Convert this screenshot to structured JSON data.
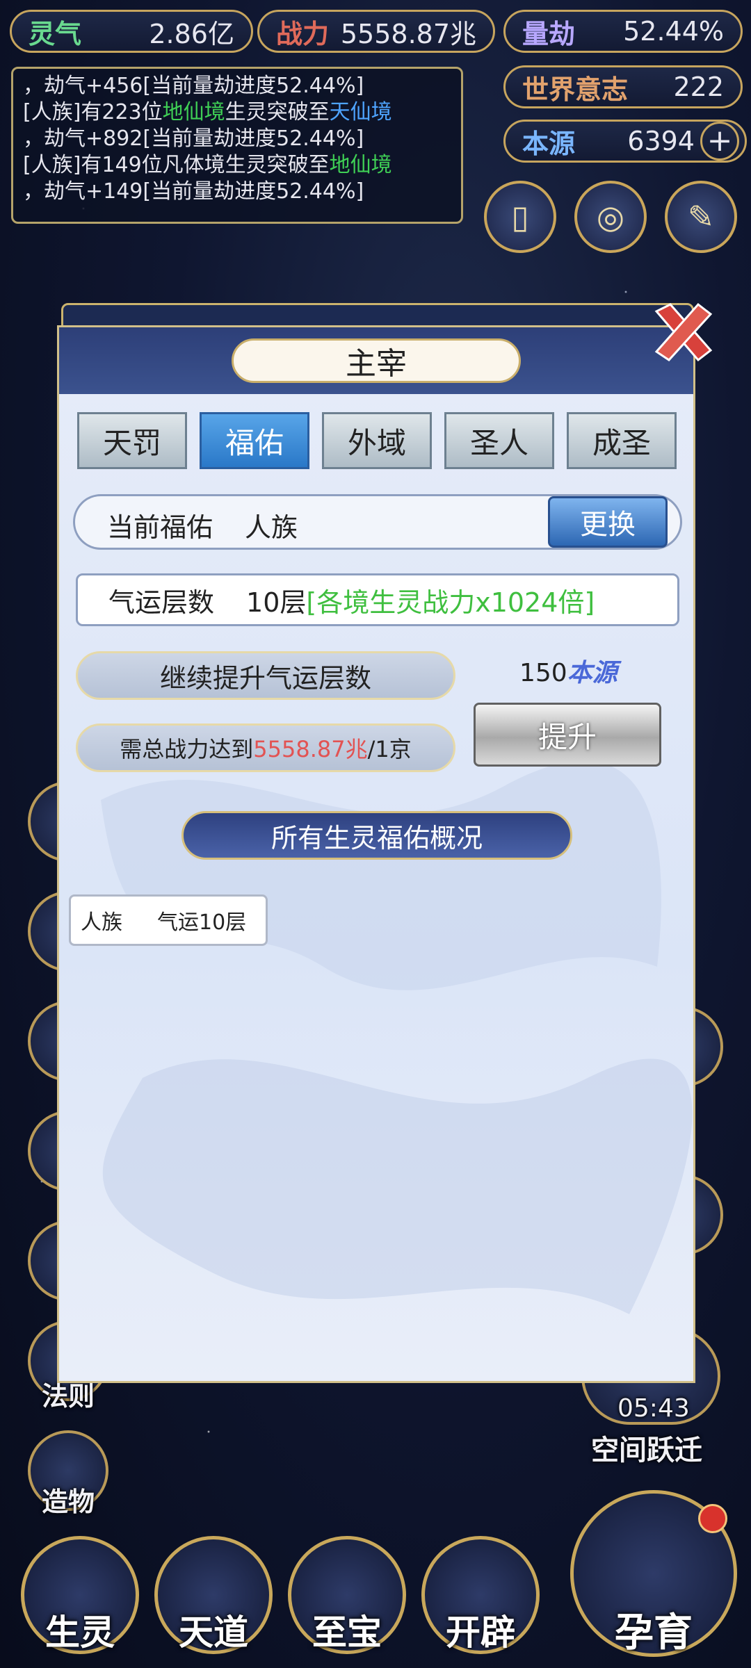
{
  "hud": {
    "lingqi": {
      "label": "灵气",
      "value": "2.86亿"
    },
    "zhanli": {
      "label": "战力",
      "value": "5558.87兆"
    },
    "liangjie": {
      "label": "量劫",
      "value": "52.44%"
    },
    "shijie": {
      "label": "世界意志",
      "value": "222"
    },
    "benyuan": {
      "label": "本源",
      "value": "6394"
    }
  },
  "log": {
    "line1": "，劫气+456[当前量劫进度52.44%]",
    "line2a": "[人族]有223位",
    "line2b": "地仙境",
    "line2c": "生灵突破至",
    "line2d": "天仙境",
    "line3": "，劫气+892[当前量劫进度52.44%]",
    "line4a": "[人族]有149位凡体境生灵突破至",
    "line4b": "地仙境",
    "line5": "，劫气+149[当前量劫进度52.44%]"
  },
  "side_left": [
    "法则",
    "造物"
  ],
  "space_jump": {
    "time": "05:43",
    "label": "空间跃迁"
  },
  "bottom_nav": [
    "生灵",
    "天道",
    "至宝",
    "开辟"
  ],
  "bottom_main": "孕育",
  "modal": {
    "title": "主宰",
    "tabs": [
      "天罚",
      "福佑",
      "外域",
      "圣人",
      "成圣"
    ],
    "active_tab": "福佑",
    "current": {
      "label": "当前福佑",
      "value": "人族",
      "change_button": "更换"
    },
    "luck": {
      "label": "气运层数",
      "layers": "10层",
      "bonus": "[各境生灵战力x1024倍]"
    },
    "continue_label": "继续提升气运层数",
    "requirement": {
      "prefix": "需总战力达到",
      "current": "5558.87兆",
      "target": "/1京"
    },
    "cost": {
      "amount": "150",
      "unit": "本源"
    },
    "upgrade_button": "提升",
    "overview_title": "所有生灵福佑概况",
    "entries": [
      {
        "race": "人族",
        "luck": "气运10层"
      }
    ]
  },
  "colors": {
    "accent_gold": "#c9a85b",
    "active_tab": "#2a78c8",
    "bonus_green": "#3fbf3f",
    "warn_red": "#e25353"
  }
}
